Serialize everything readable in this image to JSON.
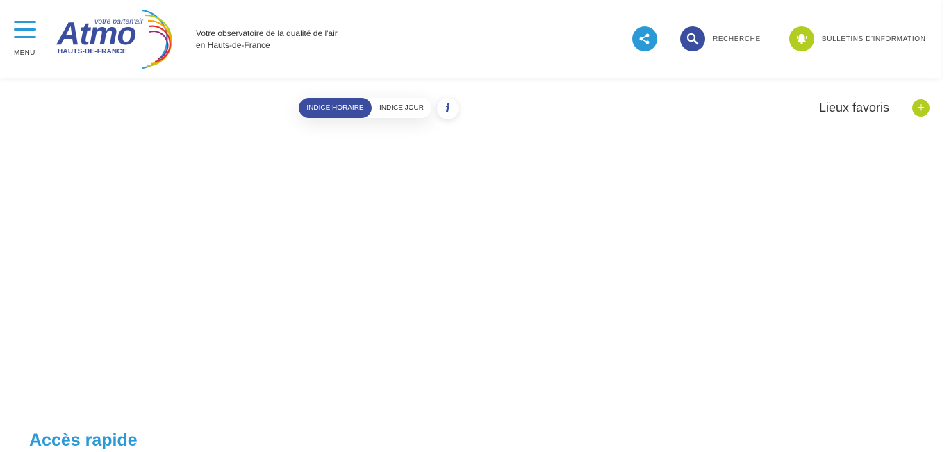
{
  "header": {
    "menu_label": "MENU",
    "logo": {
      "tagline": "votre parten’air",
      "word": "Atmo",
      "region": "HAUTS-DE-FRANCE"
    },
    "tagline_line1": "Votre observatoire de la qualité de l'air",
    "tagline_line2": "en Hauts-de-France",
    "share_icon": "share-icon",
    "search_icon": "search-icon",
    "search_label": "RECHERCHE",
    "bell_icon": "bell-icon",
    "bulletins_label": "BULLETINS D'INFORMATION"
  },
  "index_toggle": {
    "options": [
      "INDICE HORAIRE",
      "INDICE JOUR"
    ],
    "selected": "INDICE HORAIRE",
    "info_label": "i"
  },
  "favorites": {
    "title": "Lieux favoris",
    "add_label": "+"
  },
  "quick_access": {
    "title": "Accès rapide"
  },
  "colors": {
    "primary_blue": "#3a4d9f",
    "light_blue": "#2a9ad6",
    "green": "#b2cc20"
  }
}
